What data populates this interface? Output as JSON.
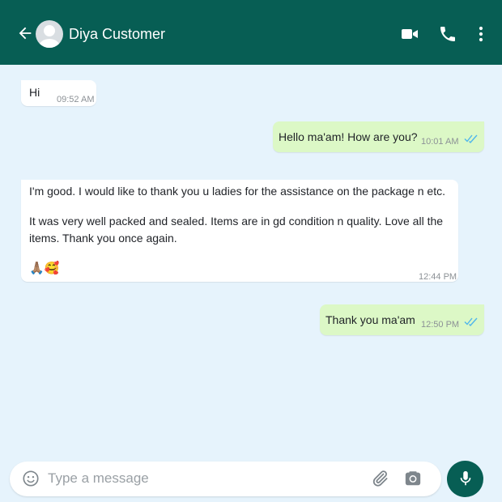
{
  "header": {
    "contact_name": "Diya Customer",
    "background_color": "#075e54",
    "icons": [
      "back-arrow-icon",
      "avatar-placeholder",
      "video-call-icon",
      "phone-icon",
      "more-options-icon"
    ]
  },
  "messages": [
    {
      "direction": "incoming",
      "text": "Hi",
      "time": "09:52 AM"
    },
    {
      "direction": "outgoing",
      "text": "Hello ma'am! How are you?",
      "time": "10:01 AM",
      "status": "read"
    },
    {
      "direction": "incoming",
      "paragraphs": [
        "I'm good. I would like to thank you u ladies for the assistance on the package n etc.",
        "It was very well packed and sealed. Items are in gd condition n quality. Love all the items. Thank you once again."
      ],
      "emoji": "🙏🏽🥰",
      "time": "12:44 PM"
    },
    {
      "direction": "outgoing",
      "text": "Thank you ma'am",
      "time": "12:50 PM",
      "status": "read"
    }
  ],
  "composer": {
    "placeholder": "Type a message",
    "value": "",
    "icons": [
      "emoji-icon",
      "attach-icon",
      "camera-icon",
      "mic-icon"
    ]
  },
  "colors": {
    "chat_background": "#e6f3fc",
    "outgoing_bubble": "#dcf8c6",
    "incoming_bubble": "#ffffff",
    "read_ticks": "#4fb6ec"
  }
}
